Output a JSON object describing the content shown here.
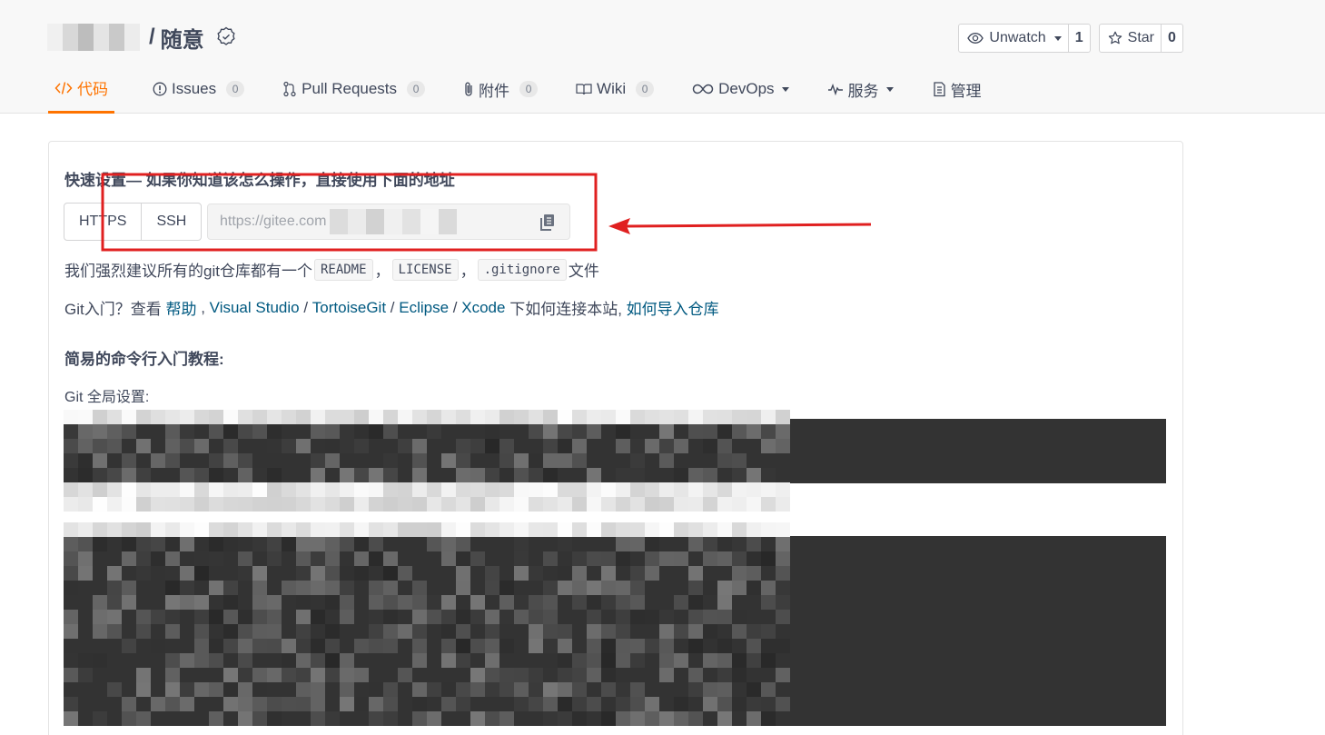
{
  "repo": {
    "owner_redacted": true,
    "separator": "/",
    "name": "随意"
  },
  "header_buttons": {
    "watch": {
      "label": "Unwatch",
      "count": "1"
    },
    "star": {
      "label": "Star",
      "count": "0"
    }
  },
  "tabs": [
    {
      "label": "代码",
      "icon": "code-icon",
      "active": true
    },
    {
      "label": "Issues",
      "icon": "issue-icon",
      "count": "0"
    },
    {
      "label": "Pull Requests",
      "icon": "pull-request-icon",
      "count": "0"
    },
    {
      "label": "附件",
      "icon": "paperclip-icon",
      "count": "0"
    },
    {
      "label": "Wiki",
      "icon": "book-icon",
      "count": "0"
    },
    {
      "label": "DevOps",
      "icon": "infinity-icon",
      "dropdown": true
    },
    {
      "label": "服务",
      "icon": "pulse-icon",
      "dropdown": true
    },
    {
      "label": "管理",
      "icon": "clipboard-icon"
    }
  ],
  "quick_setup": {
    "title": "快速设置— 如果你知道该怎么操作，直接使用下面的地址",
    "protocols": [
      "HTTPS",
      "SSH"
    ],
    "url_prefix": "https://gitee.com"
  },
  "recommend": {
    "prefix": "我们强烈建议所有的git仓库都有一个",
    "files": [
      "README",
      "LICENSE",
      ".gitignore"
    ],
    "comma": "，",
    "suffix": "文件"
  },
  "getting_started": {
    "prefix": "Git入门？查看",
    "help_link": "帮助",
    "comma": ",",
    "links": [
      "Visual Studio",
      "TortoiseGit",
      "Eclipse",
      "Xcode"
    ],
    "slash": "/",
    "middle": "下如何连接本站,",
    "import_link": "如何导入仓库"
  },
  "tutorial": {
    "title": "简易的命令行入门教程:",
    "global_settings_label": "Git 全局设置:"
  },
  "colors": {
    "accent": "#fe7300",
    "link": "#005980",
    "code_bg": "#333333",
    "annotation_red": "#e02020"
  }
}
